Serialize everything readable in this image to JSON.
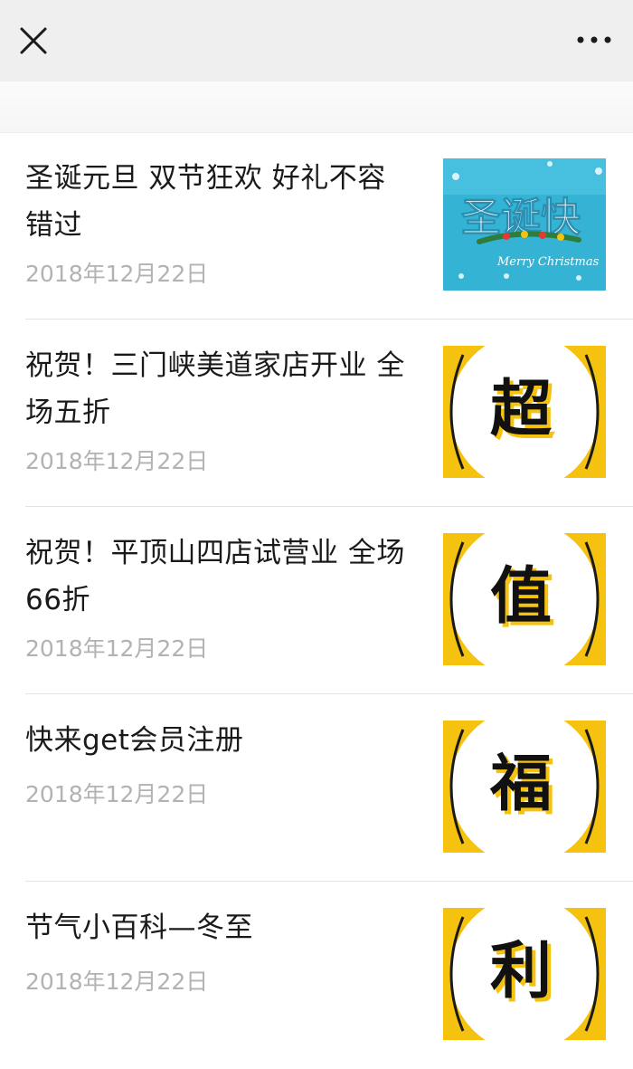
{
  "header": {
    "close_icon": "close-icon",
    "more_icon": "more-icon"
  },
  "articles": [
    {
      "title": "圣诞元旦 双节狂欢 好礼不容错过",
      "date": "2018年12月22日",
      "thumb_text": "圣诞快",
      "thumb_subtext": "Merry Christmas"
    },
    {
      "title": "祝贺！三门峡美道家店开业 全场五折",
      "date": "2018年12月22日",
      "thumb_text": "超"
    },
    {
      "title": "祝贺！平顶山四店试营业 全场66折",
      "date": "2018年12月22日",
      "thumb_text": "值"
    },
    {
      "title": "快来get会员注册",
      "date": "2018年12月22日",
      "thumb_text": "福"
    },
    {
      "title": "节气小百科—冬至",
      "date": "2018年12月22日",
      "thumb_text": "利"
    }
  ],
  "colors": {
    "accent_yellow": "#f5c20f",
    "xmas_blue": "#32b7d6",
    "title_text": "#1a1a1a",
    "date_text": "#b2b2b2"
  }
}
